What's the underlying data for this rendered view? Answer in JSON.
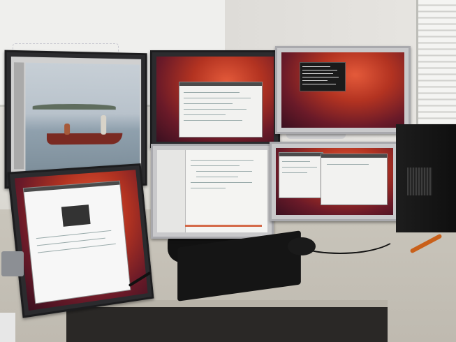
{
  "scene": {
    "monitors": [
      {
        "id": "top-left",
        "content": "image-editor-photo"
      },
      {
        "id": "top-center",
        "content": "text-editor"
      },
      {
        "id": "top-right",
        "content": "terminal"
      },
      {
        "id": "bottom-left",
        "content": "web-browser"
      },
      {
        "id": "bottom-center",
        "content": "code-editor"
      },
      {
        "id": "bottom-right",
        "content": "two-windows"
      }
    ],
    "colors": {
      "desktop_wallpaper": "#b33321",
      "desk": "#c9c5bb",
      "screwdriver_handle": "#c9601a"
    },
    "icons": [
      "keyboard-icon",
      "mouse-icon",
      "pc-tower-icon",
      "screwdriver-icon",
      "pen-icon"
    ]
  }
}
